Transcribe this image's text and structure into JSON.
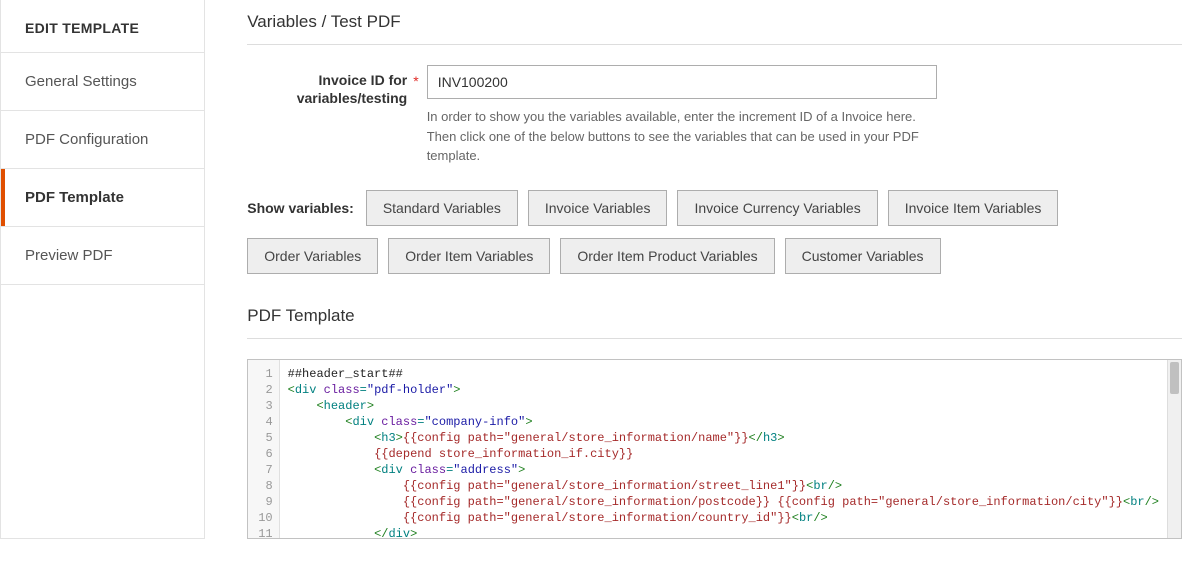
{
  "sidebar": {
    "header": "EDIT TEMPLATE",
    "items": [
      {
        "label": "General Settings",
        "active": false
      },
      {
        "label": "PDF Configuration",
        "active": false
      },
      {
        "label": "PDF Template",
        "active": true
      },
      {
        "label": "Preview PDF",
        "active": false
      }
    ]
  },
  "variables_section": {
    "title": "Variables / Test PDF",
    "field_label": "Invoice ID for variables/testing",
    "required_mark": "*",
    "input_value": "INV100200",
    "hint": "In order to show you the variables available, enter the increment ID of a Invoice here. Then click one of the below buttons to see the variables that can be used in your PDF template.",
    "show_variables_label": "Show variables:",
    "buttons_row1": [
      "Standard Variables",
      "Invoice Variables",
      "Invoice Currency Variables",
      "Invoice Item Variables"
    ],
    "buttons_row2": [
      "Order Variables",
      "Order Item Variables",
      "Order Item Product Variables",
      "Customer Variables"
    ]
  },
  "template_section": {
    "title": "PDF Template",
    "code_lines": [
      {
        "n": 1,
        "tokens": [
          {
            "t": "plain",
            "v": "##header_start##"
          }
        ]
      },
      {
        "n": 2,
        "tokens": [
          {
            "t": "tag_open",
            "name": "div",
            "attrs": [
              {
                "n": "class",
                "v": "pdf-holder"
              }
            ]
          }
        ]
      },
      {
        "n": 3,
        "indent": 1,
        "tokens": [
          {
            "t": "tag_open",
            "name": "header"
          }
        ]
      },
      {
        "n": 4,
        "indent": 2,
        "tokens": [
          {
            "t": "tag_open",
            "name": "div",
            "attrs": [
              {
                "n": "class",
                "v": "company-info"
              }
            ]
          }
        ]
      },
      {
        "n": 5,
        "indent": 3,
        "tokens": [
          {
            "t": "tag_open",
            "name": "h3"
          },
          {
            "t": "mustache",
            "v": "{{config path=\"general/store_information/name\"}}"
          },
          {
            "t": "tag_close",
            "name": "h3"
          }
        ]
      },
      {
        "n": 6,
        "indent": 3,
        "tokens": [
          {
            "t": "mustache",
            "v": "{{depend store_information_if.city}}"
          }
        ]
      },
      {
        "n": 7,
        "indent": 3,
        "tokens": [
          {
            "t": "tag_open",
            "name": "div",
            "attrs": [
              {
                "n": "class",
                "v": "address"
              }
            ]
          }
        ]
      },
      {
        "n": 8,
        "indent": 4,
        "tokens": [
          {
            "t": "mustache",
            "v": "{{config path=\"general/store_information/street_line1\"}}"
          },
          {
            "t": "tag_self",
            "name": "br"
          }
        ]
      },
      {
        "n": 9,
        "indent": 4,
        "tokens": [
          {
            "t": "mustache",
            "v": "{{config path=\"general/store_information/postcode}} {{config path=\"general/store_information/city\"}}"
          },
          {
            "t": "tag_self",
            "name": "br"
          }
        ]
      },
      {
        "n": 10,
        "indent": 4,
        "tokens": [
          {
            "t": "mustache",
            "v": "{{config path=\"general/store_information/country_id\"}}"
          },
          {
            "t": "tag_self",
            "name": "br"
          }
        ]
      },
      {
        "n": 11,
        "indent": 3,
        "tokens": [
          {
            "t": "tag_close",
            "name": "div"
          }
        ]
      }
    ]
  }
}
